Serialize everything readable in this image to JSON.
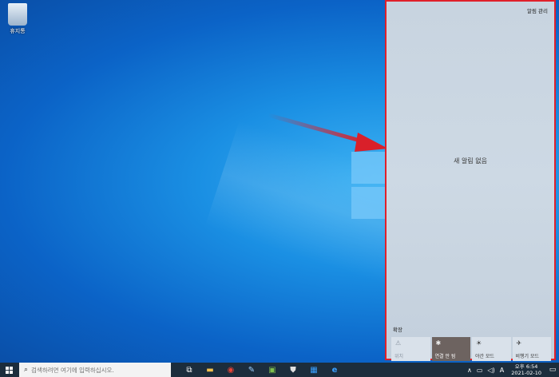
{
  "desktop": {
    "recycle_bin_label": "휴지통"
  },
  "action_center": {
    "manage_notifications": "알림 관리",
    "no_notifications": "새 알림 없음",
    "expand": "확장",
    "tiles": [
      {
        "icon": "location-icon",
        "glyph": "⚠",
        "label": "위치",
        "state": "disabled"
      },
      {
        "icon": "bluetooth-icon",
        "glyph": "✱",
        "label": "연결 안 됨",
        "state": "active"
      },
      {
        "icon": "night-light-icon",
        "glyph": "☀",
        "label": "야간 모드",
        "state": "normal"
      },
      {
        "icon": "airplane-icon",
        "glyph": "✈",
        "label": "비행기 모드",
        "state": "normal"
      }
    ]
  },
  "taskbar": {
    "search_placeholder": "검색하려면 여기에 입력하십시오.",
    "apps": [
      {
        "name": "task-view-icon",
        "glyph": "⧉",
        "color": "#ffffff"
      },
      {
        "name": "file-explorer-icon",
        "glyph": "▬",
        "color": "#f2c14e"
      },
      {
        "name": "chrome-icon",
        "glyph": "◉",
        "color": "#e94335"
      },
      {
        "name": "paint-icon",
        "glyph": "✎",
        "color": "#9cd0ff"
      },
      {
        "name": "game-icon",
        "glyph": "▣",
        "color": "#7fbf4d"
      },
      {
        "name": "store-icon",
        "glyph": "⛊",
        "color": "#e0e0e0"
      },
      {
        "name": "calendar-icon",
        "glyph": "▦",
        "color": "#3aa0ff"
      },
      {
        "name": "edge-icon",
        "glyph": "e",
        "color": "#3aa0ff"
      }
    ],
    "tray": {
      "chevron": "∧",
      "ime": "A",
      "time": "오후 6:54",
      "date": "2021-02-10"
    }
  },
  "colors": {
    "highlight_border": "#e0202a",
    "arrow": "#d9202a"
  }
}
